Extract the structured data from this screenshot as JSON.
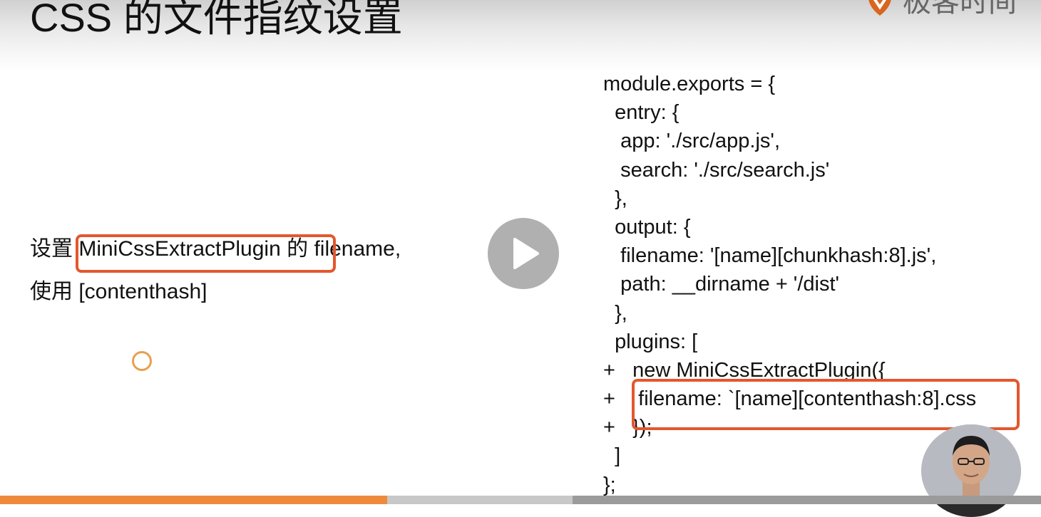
{
  "slide": {
    "title": "CSS 的文件指纹设置",
    "logo_text": "极客时间",
    "bullet_line1": {
      "prefix": "设置",
      "highlight": "MiniCssExtractPlugin",
      "suffix": "的 filename,"
    },
    "bullet_line2": "使用 [contenthash]"
  },
  "code": {
    "lines": [
      "module.exports = {",
      "  entry: {",
      "   app: './src/app.js',",
      "   search: './src/search.js'",
      "  },",
      "  output: {",
      "   filename: '[name][chunkhash:8].js',",
      "   path: __dirname + '/dist'",
      "  },",
      "  plugins: [",
      "+   new MiniCssExtractPlugin({",
      "+    filename: `[name][contenthash:8].css",
      "+   });",
      "  ]",
      "};"
    ]
  },
  "player": {
    "play_icon": "play-icon",
    "progress_fraction": 0.372,
    "buffer_fraction": 0.55
  },
  "colors": {
    "highlight": "#e4572e",
    "progress": "#ef8a3c",
    "logo": "#d9651e"
  }
}
